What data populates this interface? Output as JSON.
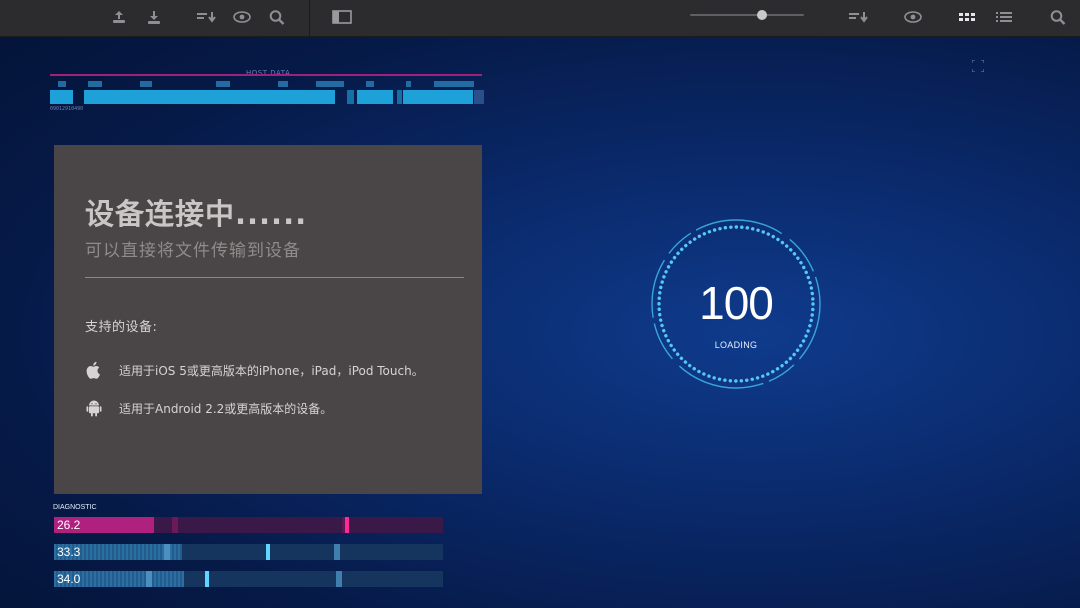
{
  "toolbar": {
    "left_icons": [
      "upload-icon",
      "download-icon",
      "sort-down-icon",
      "eye-icon",
      "search-icon"
    ],
    "right_icons": [
      "sort-down-icon",
      "eye-icon",
      "grid-view-icon",
      "list-view-icon",
      "search-icon"
    ],
    "sidebar_toggle_icon": "sidebar-toggle-icon"
  },
  "host": {
    "label": "HOST DATA",
    "code": "09012910490"
  },
  "card": {
    "title": "设备连接中......",
    "subtitle": "可以直接将文件传输到设备",
    "support_heading": "支持的设备:",
    "devices": [
      {
        "icon": "apple-icon",
        "text": "适用于iOS 5或更高版本的iPhone，iPad，iPod Touch。"
      },
      {
        "icon": "android-icon",
        "text": "适用于Android 2.2或更高版本的设备。"
      }
    ]
  },
  "loader": {
    "value": "100",
    "label": "LOADING"
  },
  "diagnostic": {
    "label": "DIAGNOSTIC",
    "rows": [
      {
        "value": "26.2",
        "color": "#b0207e"
      },
      {
        "value": "33.3",
        "color": "#2b6ea3"
      },
      {
        "value": "34.0",
        "color": "#2b6ea3"
      }
    ]
  },
  "colors": {
    "accent_cyan": "#4cc4f0",
    "accent_magenta": "#e0208a",
    "card_bg": "#4a4647"
  }
}
